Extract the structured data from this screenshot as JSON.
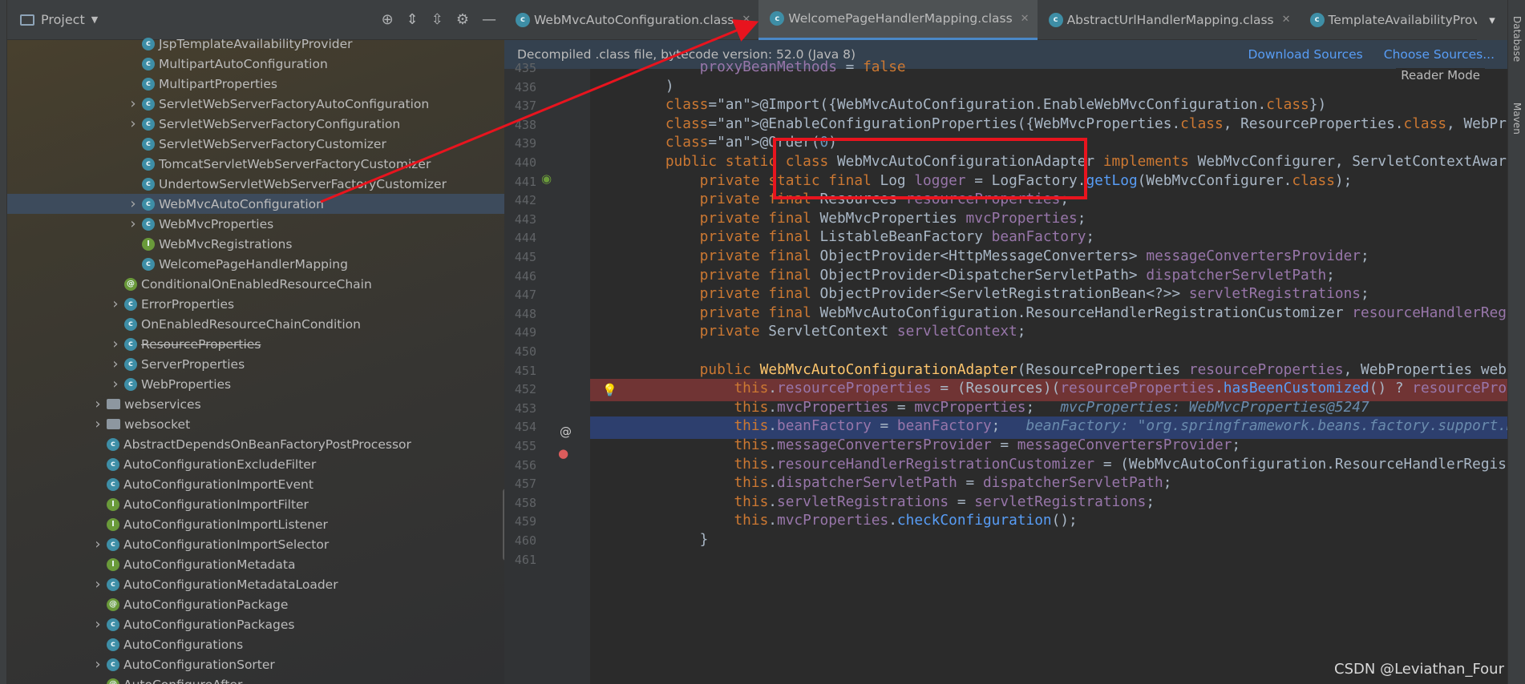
{
  "project_panel": {
    "title": "Project",
    "tree": [
      {
        "label": "JspTemplateAvailabilityProvider",
        "icon": "class-icon",
        "expandable": false,
        "strike": false
      },
      {
        "label": "MultipartAutoConfiguration",
        "icon": "class-icon",
        "expandable": false,
        "strike": false
      },
      {
        "label": "MultipartProperties",
        "icon": "class-icon",
        "expandable": false,
        "strike": false
      },
      {
        "label": "ServletWebServerFactoryAutoConfiguration",
        "icon": "class-icon",
        "expandable": true,
        "strike": false
      },
      {
        "label": "ServletWebServerFactoryConfiguration",
        "icon": "class-icon",
        "expandable": true,
        "strike": false
      },
      {
        "label": "ServletWebServerFactoryCustomizer",
        "icon": "class-icon",
        "expandable": false,
        "strike": false
      },
      {
        "label": "TomcatServletWebServerFactoryCustomizer",
        "icon": "class-icon",
        "expandable": false,
        "strike": false
      },
      {
        "label": "UndertowServletWebServerFactoryCustomizer",
        "icon": "class-icon",
        "expandable": false,
        "strike": false
      },
      {
        "label": "WebMvcAutoConfiguration",
        "icon": "class-icon",
        "expandable": true,
        "strike": false,
        "selected": true
      },
      {
        "label": "WebMvcProperties",
        "icon": "class-icon",
        "expandable": true,
        "strike": false
      },
      {
        "label": "WebMvcRegistrations",
        "icon": "interface-icon",
        "expandable": false,
        "strike": false
      },
      {
        "label": "WelcomePageHandlerMapping",
        "icon": "class-icon",
        "expandable": false,
        "strike": false
      },
      {
        "label": "ConditionalOnEnabledResourceChain",
        "icon": "annotation-icon",
        "expandable": false,
        "strike": false
      },
      {
        "label": "ErrorProperties",
        "icon": "class-icon",
        "expandable": true,
        "strike": false
      },
      {
        "label": "OnEnabledResourceChainCondition",
        "icon": "class-icon",
        "expandable": false,
        "strike": false
      },
      {
        "label": "ResourceProperties",
        "icon": "class-icon",
        "expandable": true,
        "strike": true
      },
      {
        "label": "ServerProperties",
        "icon": "class-icon",
        "expandable": true,
        "strike": false
      },
      {
        "label": "WebProperties",
        "icon": "class-icon",
        "expandable": true,
        "strike": false
      },
      {
        "label": "webservices",
        "icon": "folder-icon",
        "expandable": true,
        "strike": false
      },
      {
        "label": "websocket",
        "icon": "folder-icon",
        "expandable": true,
        "strike": false
      },
      {
        "label": "AbstractDependsOnBeanFactoryPostProcessor",
        "icon": "class-icon",
        "expandable": false,
        "strike": false
      },
      {
        "label": "AutoConfigurationExcludeFilter",
        "icon": "class-icon",
        "expandable": false,
        "strike": false
      },
      {
        "label": "AutoConfigurationImportEvent",
        "icon": "class-icon",
        "expandable": false,
        "strike": false
      },
      {
        "label": "AutoConfigurationImportFilter",
        "icon": "interface-icon",
        "expandable": false,
        "strike": false
      },
      {
        "label": "AutoConfigurationImportListener",
        "icon": "interface-icon",
        "expandable": false,
        "strike": false
      },
      {
        "label": "AutoConfigurationImportSelector",
        "icon": "class-icon",
        "expandable": true,
        "strike": false
      },
      {
        "label": "AutoConfigurationMetadata",
        "icon": "interface-icon",
        "expandable": false,
        "strike": false
      },
      {
        "label": "AutoConfigurationMetadataLoader",
        "icon": "class-icon",
        "expandable": true,
        "strike": false
      },
      {
        "label": "AutoConfigurationPackage",
        "icon": "annotation-icon",
        "expandable": false,
        "strike": false
      },
      {
        "label": "AutoConfigurationPackages",
        "icon": "class-icon",
        "expandable": true,
        "strike": false
      },
      {
        "label": "AutoConfigurations",
        "icon": "class-icon",
        "expandable": false,
        "strike": false
      },
      {
        "label": "AutoConfigurationSorter",
        "icon": "class-icon",
        "expandable": true,
        "strike": false
      },
      {
        "label": "AutoConfigureAfter",
        "icon": "annotation-icon",
        "expandable": false,
        "strike": false
      }
    ]
  },
  "tabs": [
    {
      "label": "WebMvcAutoConfiguration.class",
      "active": false
    },
    {
      "label": "WelcomePageHandlerMapping.class",
      "active": true
    },
    {
      "label": "AbstractUrlHandlerMapping.class",
      "active": false
    },
    {
      "label": "TemplateAvailabilityProviders.cl",
      "active": false
    }
  ],
  "banner": {
    "text": "Decompiled .class file, bytecode version: 52.0 (Java 8)",
    "download_sources": "Download Sources",
    "choose_sources": "Choose Sources..."
  },
  "reader_mode": "Reader Mode",
  "right_strip": {
    "database": "Database",
    "maven": "Maven"
  },
  "watermark": "CSDN @Leviathan_Four",
  "code_lines": [
    {
      "n": "435",
      "text": "        proxyBeanMethods = false"
    },
    {
      "n": "436",
      "text": "    )"
    },
    {
      "n": "437",
      "text": "    @Import({WebMvcAutoConfiguration.EnableWebMvcConfiguration.class})"
    },
    {
      "n": "438",
      "text": "    @EnableConfigurationProperties({WebMvcProperties.class, ResourceProperties.class, WebProperties.cla"
    },
    {
      "n": "439",
      "text": "    @Order(0)"
    },
    {
      "n": "440",
      "text": "    public static class WebMvcAutoConfigurationAdapter implements WebMvcConfigurer, ServletContextAware"
    },
    {
      "n": "441",
      "text": "        private static final Log logger = LogFactory.getLog(WebMvcConfigurer.class);"
    },
    {
      "n": "442",
      "text": "        private final Resources resourceProperties;"
    },
    {
      "n": "443",
      "text": "        private final WebMvcProperties mvcProperties;"
    },
    {
      "n": "444",
      "text": "        private final ListableBeanFactory beanFactory;"
    },
    {
      "n": "445",
      "text": "        private final ObjectProvider<HttpMessageConverters> messageConvertersProvider;"
    },
    {
      "n": "446",
      "text": "        private final ObjectProvider<DispatcherServletPath> dispatcherServletPath;"
    },
    {
      "n": "447",
      "text": "        private final ObjectProvider<ServletRegistrationBean<?>> servletRegistrations;"
    },
    {
      "n": "448",
      "text": "        private final WebMvcAutoConfiguration.ResourceHandlerRegistrationCustomizer resourceHandlerRegi"
    },
    {
      "n": "449",
      "text": "        private ServletContext servletContext;"
    },
    {
      "n": "450",
      "text": ""
    },
    {
      "n": "451",
      "text": "        public WebMvcAutoConfigurationAdapter(ResourceProperties resourceProperties, WebProperties webP"
    },
    {
      "n": "452",
      "text": "            this.resourceProperties = (Resources)(resourceProperties.hasBeenCustomized() ? resourceProp"
    },
    {
      "n": "453",
      "text": "            this.mvcProperties = mvcProperties;   mvcProperties: WebMvcProperties@5247"
    },
    {
      "n": "454",
      "text": "            this.beanFactory = beanFactory;   beanFactory: \"org.springframework.beans.factory.support.De"
    },
    {
      "n": "455",
      "text": "            this.messageConvertersProvider = messageConvertersProvider;"
    },
    {
      "n": "456",
      "text": "            this.resourceHandlerRegistrationCustomizer = (WebMvcAutoConfiguration.ResourceHandlerRegist"
    },
    {
      "n": "457",
      "text": "            this.dispatcherServletPath = dispatcherServletPath;"
    },
    {
      "n": "458",
      "text": "            this.servletRegistrations = servletRegistrations;"
    },
    {
      "n": "459",
      "text": "            this.mvcProperties.checkConfiguration();"
    },
    {
      "n": "460",
      "text": "        }"
    },
    {
      "n": "461",
      "text": ""
    }
  ]
}
